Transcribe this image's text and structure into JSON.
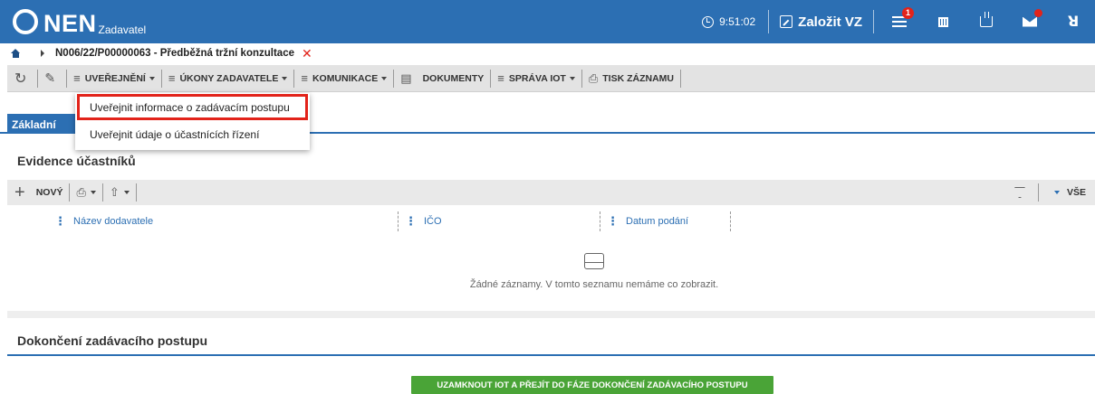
{
  "header": {
    "logo_text": "NEN",
    "logo_sub": "Zadavatel",
    "time": "9:51:02",
    "create_label": "Založit VZ",
    "menu_badge": "1",
    "user_icon_glyph": "ꓤ",
    "brand_color": "#2c6fb3"
  },
  "breadcrumb": {
    "text": "N006/22/P00000063 - Předběžná tržní konzultace",
    "close_glyph": "✕"
  },
  "toolbar": {
    "refresh_glyph": "↻",
    "edit_glyph": "✎",
    "uverejneni": "UVEŘEJNĚNÍ",
    "ukony": "ÚKONY ZADAVATELE",
    "komunikace": "KOMUNIKACE",
    "dokumenty": "DOKUMENTY",
    "sprava_iot": "SPRÁVA IOT",
    "tisk": "TISK ZÁZNAMU",
    "list_glyph": "≡",
    "doc_glyph": "▤",
    "print_glyph": "⎙"
  },
  "dropdown": {
    "items": [
      "Uveřejnit informace o zadávacím postupu",
      "Uveřejnit údaje o účastnících řízení"
    ]
  },
  "tabs": {
    "active": "Základní"
  },
  "participants": {
    "title": "Evidence účastníků",
    "new_label": "NOVÝ",
    "print_glyph": "⎙",
    "export_glyph": "⇧",
    "plus_glyph": "+",
    "filter_all": "VŠE",
    "columns": [
      "Název dodavatele",
      "IČO",
      "Datum podání"
    ],
    "empty_text": "Žádné záznamy. V tomto seznamu nemáme co zobrazit."
  },
  "completion": {
    "title": "Dokončení zadávacího postupu",
    "button": "UZAMKNOUT IOT A PŘEJÍT DO FÁZE DOKONČENÍ ZADÁVACÍHO POSTUPU",
    "button_color": "#4aa437"
  }
}
